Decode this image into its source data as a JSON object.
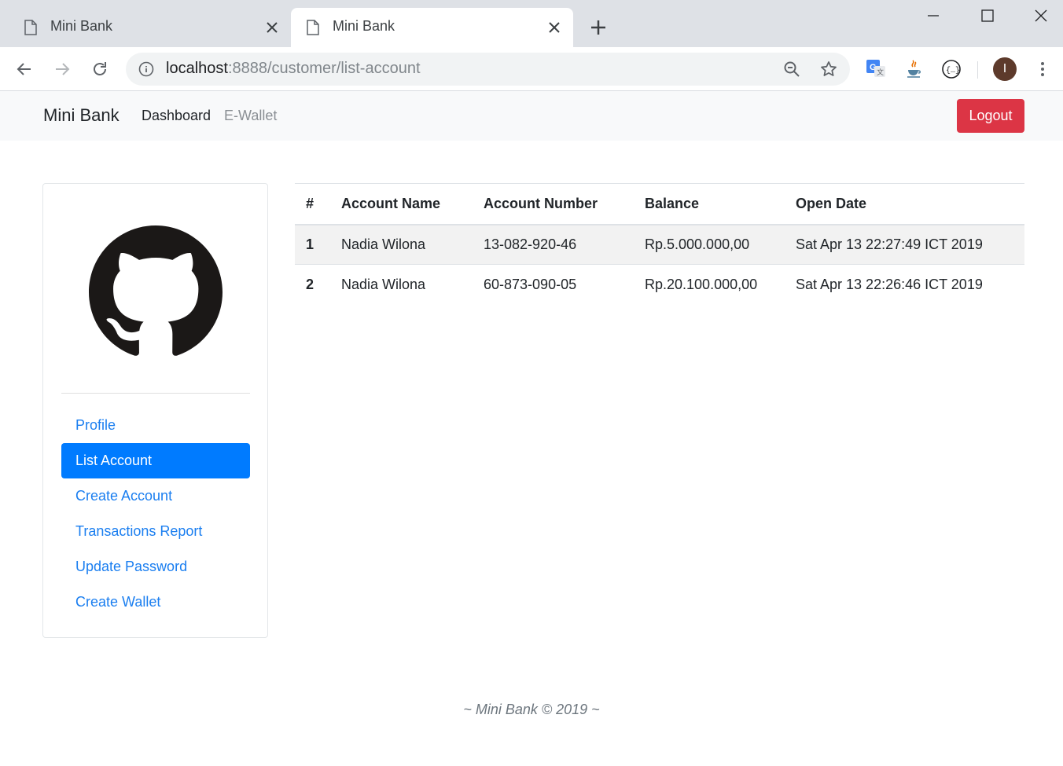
{
  "browser": {
    "tabs": [
      {
        "title": "Mini Bank",
        "active": false
      },
      {
        "title": "Mini Bank",
        "active": true
      }
    ],
    "url": {
      "host": "localhost",
      "rest": ":8888/customer/list-account"
    },
    "profile_initial": "I"
  },
  "navbar": {
    "brand": "Mini Bank",
    "links": [
      "Dashboard",
      "E-Wallet"
    ],
    "logout_label": "Logout",
    "logout_color": "#dc3545"
  },
  "sidebar": {
    "items": [
      {
        "label": "Profile",
        "active": false
      },
      {
        "label": "List Account",
        "active": true
      },
      {
        "label": "Create Account",
        "active": false
      },
      {
        "label": "Transactions Report",
        "active": false
      },
      {
        "label": "Update Password",
        "active": false
      },
      {
        "label": "Create Wallet",
        "active": false
      }
    ],
    "link_color": "#1a7ef0",
    "active_color": "#007bff"
  },
  "table": {
    "headers": [
      "#",
      "Account Name",
      "Account Number",
      "Balance",
      "Open Date"
    ],
    "rows": [
      {
        "no": "1",
        "name": "Nadia Wilona",
        "number": "13-082-920-46",
        "balance": "Rp.5.000.000,00",
        "open_date": "Sat Apr 13 22:27:49 ICT 2019"
      },
      {
        "no": "2",
        "name": "Nadia Wilona",
        "number": "60-873-090-05",
        "balance": "Rp.20.100.000,00",
        "open_date": "Sat Apr 13 22:26:46 ICT 2019"
      }
    ]
  },
  "footer": {
    "text": "~ Mini Bank © 2019 ~"
  }
}
